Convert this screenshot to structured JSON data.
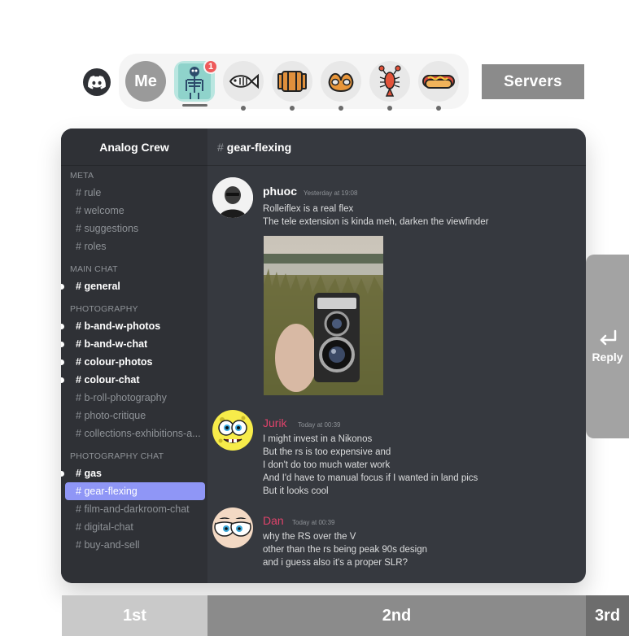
{
  "server_bar": {
    "me_label": "Me",
    "badge_count": "1",
    "servers": [
      {
        "name": "discord-logo",
        "icon": "discord-icon"
      },
      {
        "name": "me",
        "icon": "me"
      },
      {
        "name": "skeleton-xray",
        "icon": "skeleton-icon",
        "active": true
      },
      {
        "name": "fish",
        "icon": "fish-icon"
      },
      {
        "name": "barrel",
        "icon": "barrel-icon"
      },
      {
        "name": "pretzel",
        "icon": "pretzel-icon"
      },
      {
        "name": "lobster",
        "icon": "lobster-icon"
      },
      {
        "name": "hotdog",
        "icon": "hotdog-icon"
      }
    ],
    "label": "Servers"
  },
  "guild": {
    "name": "Analog Crew"
  },
  "channel_list": {
    "categories": [
      {
        "name": "META",
        "channels": [
          {
            "name": "rule",
            "unread": false
          },
          {
            "name": "welcome",
            "unread": false
          },
          {
            "name": "suggestions",
            "unread": false
          },
          {
            "name": "roles",
            "unread": false
          }
        ]
      },
      {
        "name": "MAIN CHAT",
        "channels": [
          {
            "name": "general",
            "unread": true
          }
        ]
      },
      {
        "name": "PHOTOGRAPHY",
        "channels": [
          {
            "name": "b-and-w-photos",
            "unread": true
          },
          {
            "name": "b-and-w-chat",
            "unread": true
          },
          {
            "name": "colour-photos",
            "unread": true
          },
          {
            "name": "colour-chat",
            "unread": true
          },
          {
            "name": "b-roll-photography",
            "unread": false
          },
          {
            "name": "photo-critique",
            "unread": false
          },
          {
            "name": "collections-exhibitions-a...",
            "unread": false
          }
        ]
      },
      {
        "name": "PHOTOGRAPHY CHAT",
        "channels": [
          {
            "name": "gas",
            "unread": true
          },
          {
            "name": "gear-flexing",
            "selected": true
          },
          {
            "name": "film-and-darkroom-chat",
            "unread": false
          },
          {
            "name": "digital-chat",
            "unread": false
          },
          {
            "name": "buy-and-sell",
            "unread": false
          }
        ]
      }
    ]
  },
  "chat": {
    "hash": "#",
    "channel_name": "gear-flexing",
    "messages": [
      {
        "author": "phuoc",
        "timestamp": "Yesterday at 19:08",
        "lines": [
          "Rolleiflex is a real flex",
          "The tele extension is kinda meh, darken the viewfinder"
        ],
        "has_image": true
      },
      {
        "author": "Jurik",
        "timestamp": "Today at 00:39",
        "lines": [
          "I might invest in a Nikonos",
          "But the rs is too expensive and",
          "I don't do too much water work",
          "And I'd have to manual focus if I wanted in land pics",
          "But it looks cool"
        ]
      },
      {
        "author": "Dan",
        "timestamp": "Today at 00:39",
        "lines": [
          "why the RS over the V",
          "other than the rs being peak 90s design",
          "and i guess also it's a proper SLR?"
        ]
      }
    ]
  },
  "reply_panel": {
    "label": "Reply",
    "icon": "reply-arrow-icon"
  },
  "column_labels": {
    "first": "1st",
    "second": "2nd",
    "third": "3rd"
  }
}
